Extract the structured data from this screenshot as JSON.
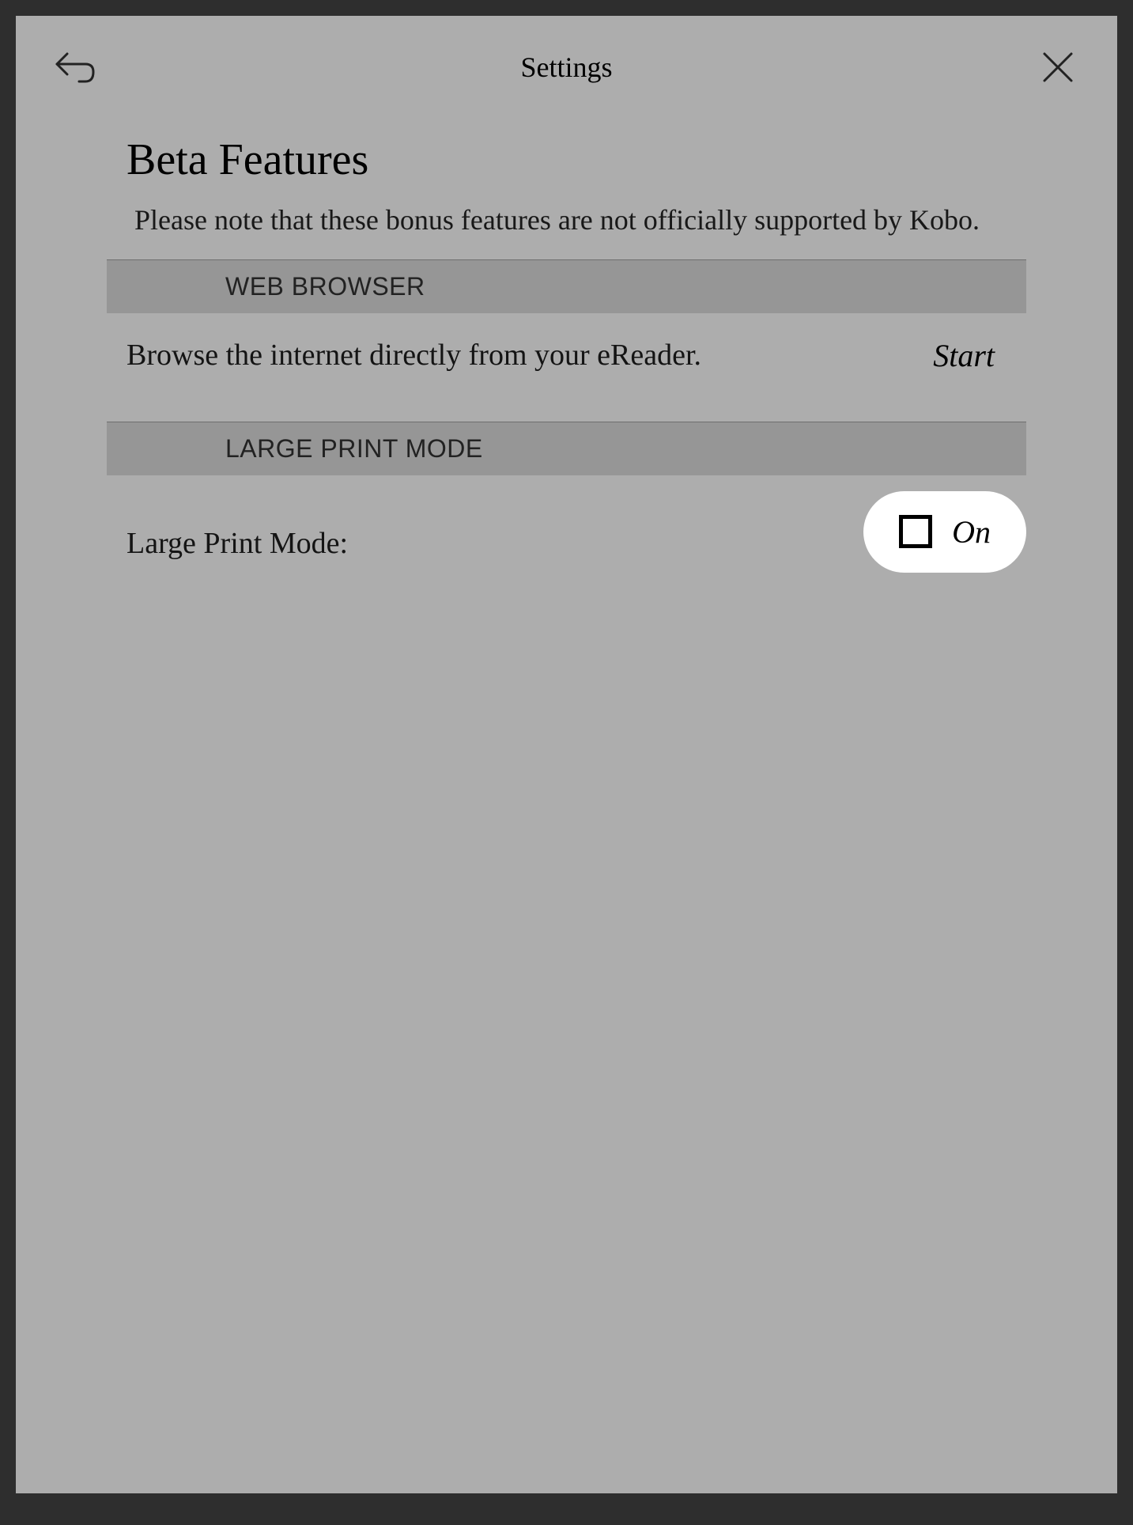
{
  "header": {
    "title": "Settings"
  },
  "page": {
    "title": "Beta Features",
    "subtitle": "Please note that these bonus features are not officially supported by Kobo."
  },
  "sections": {
    "web_browser": {
      "header": "WEB BROWSER",
      "description": "Browse the internet directly from your eReader.",
      "action_label": "Start"
    },
    "large_print": {
      "header": "LARGE PRINT MODE",
      "label": "Large Print Mode:",
      "toggle_label": "On"
    }
  }
}
